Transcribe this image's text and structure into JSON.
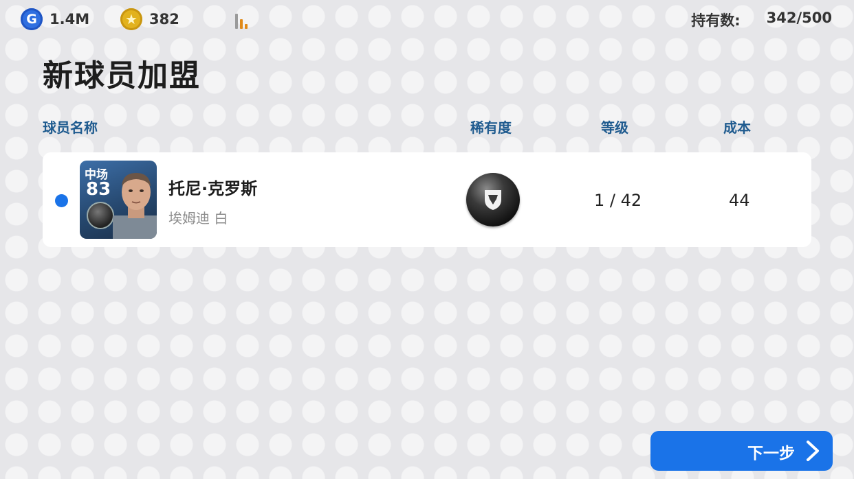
{
  "topbar": {
    "gp_icon_letter": "G",
    "gp_value": "1.4M",
    "coins_value": "382",
    "owned_label": "持有数:",
    "owned_value": "342/500",
    "icons": [
      "g-points-icon",
      "coin-star-icon",
      "signal-bars-icon"
    ]
  },
  "title": "新球员加盟",
  "columns": {
    "player_name": "球员名称",
    "rarity": "稀有度",
    "level": "等级",
    "cost": "成本"
  },
  "player": {
    "position": "中场",
    "rating": "83",
    "name": "托尼·克罗斯",
    "club": "埃姆迪 白",
    "level": "1 / 42",
    "cost": "44"
  },
  "next_button": {
    "label": "下一步"
  },
  "colors": {
    "accent": "#1a73e8",
    "header_text": "#1f5b8f",
    "card_blue": "#2f5a8c"
  }
}
